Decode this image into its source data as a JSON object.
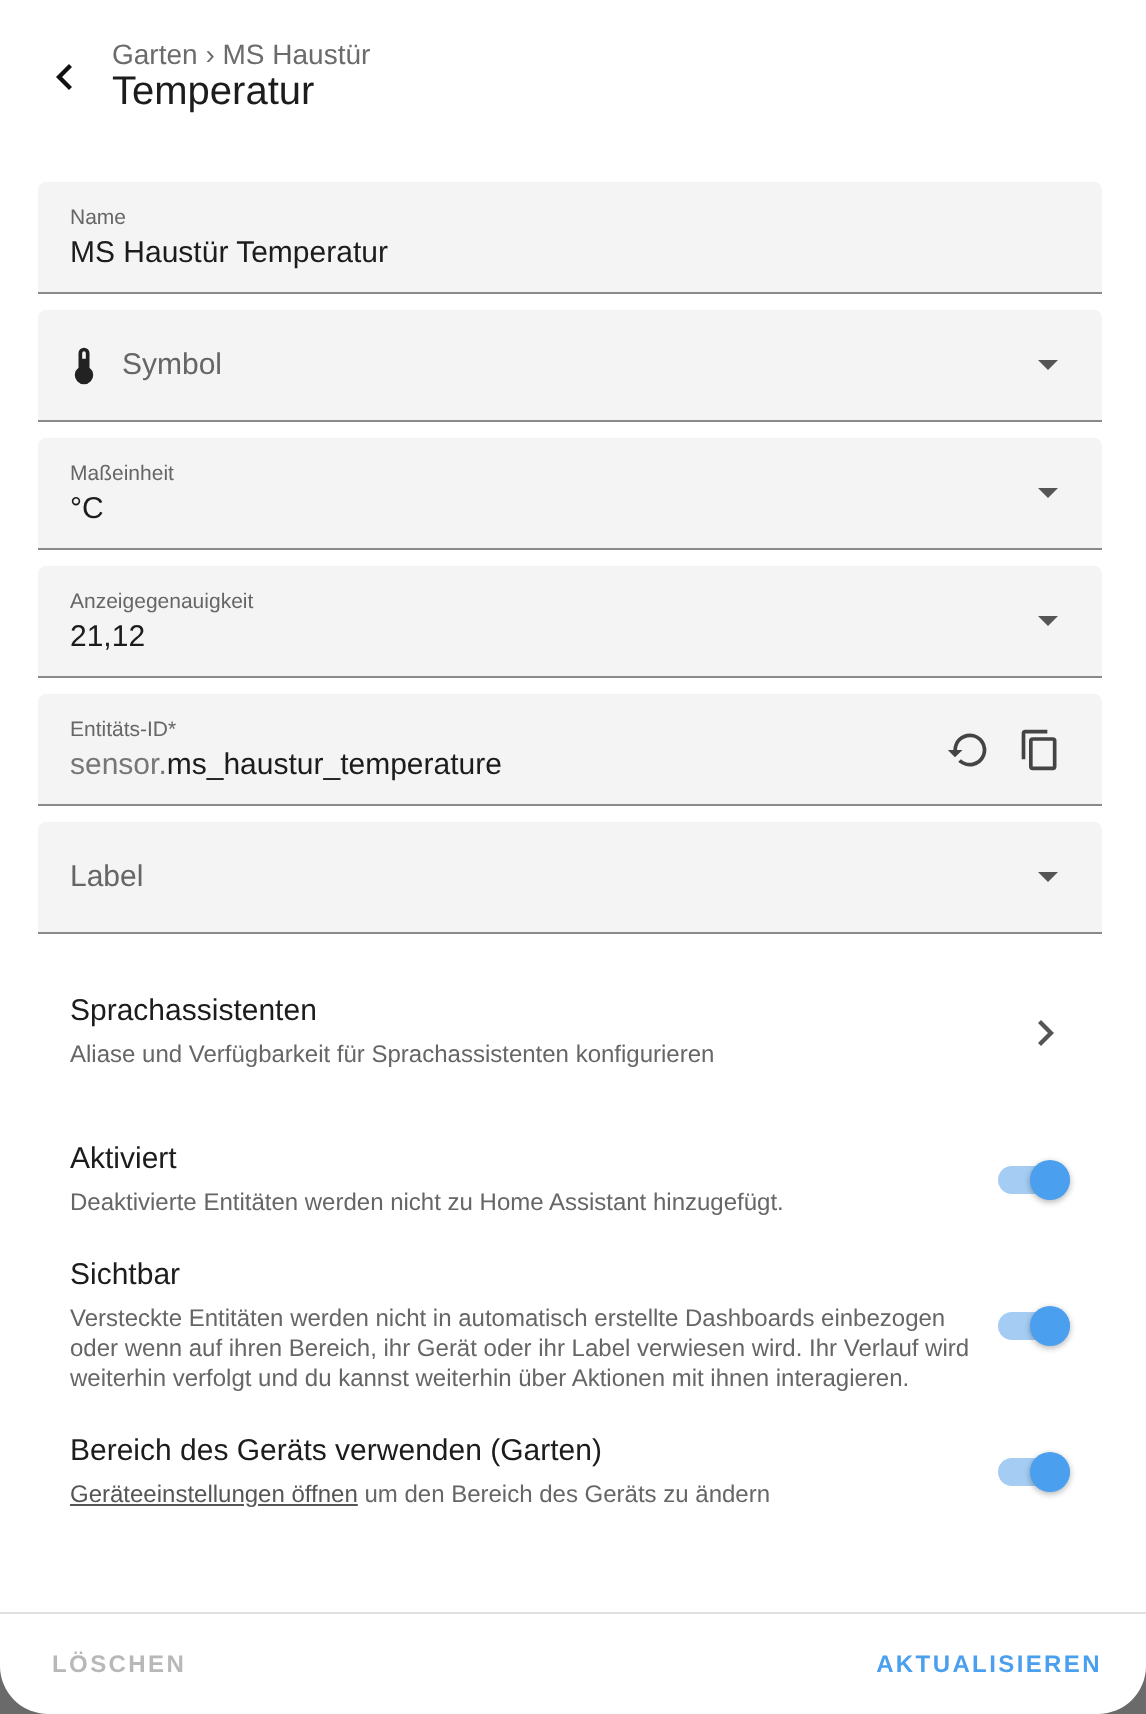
{
  "header": {
    "breadcrumb": "Garten › MS Haustür",
    "title": "Temperatur"
  },
  "fields": [
    {
      "kind": "text",
      "label": "Name",
      "value": "MS Haustür Temperatur"
    },
    {
      "kind": "icon-select",
      "placeholder": "Symbol"
    },
    {
      "kind": "select",
      "label": "Maßeinheit",
      "value": "°C"
    },
    {
      "kind": "select",
      "label": "Anzeigegenauigkeit",
      "value": "21,12"
    },
    {
      "kind": "entity",
      "label": "Entitäts-ID*",
      "prefix": "sensor.",
      "value": "ms_haustur_temperature"
    },
    {
      "kind": "select",
      "placeholder": "Label"
    }
  ],
  "nav": {
    "title": "Sprachassistenten",
    "description": "Aliase und Verfügbarkeit für Sprachassistenten konfigurieren"
  },
  "toggles": [
    {
      "title": "Aktiviert",
      "description": "Deaktivierte Entitäten werden nicht zu Home Assistant hinzugefügt.",
      "on": true
    },
    {
      "title": "Sichtbar",
      "description": "Versteckte Entitäten werden nicht in automatisch erstellte Dashboards einbezogen oder wenn auf ihren Bereich, ihr Gerät oder ihr Label verwiesen wird. Ihr Verlauf wird weiterhin verfolgt und du kannst weiterhin über Aktionen mit ihnen interagieren.",
      "on": true
    },
    {
      "title": "Bereich des Geräts verwenden (Garten)",
      "link": "Geräteeinstellungen öffnen",
      "description": "um den Bereich des Geräts zu ändern",
      "on": true
    }
  ],
  "buttons": [
    {
      "label": "LÖSCHEN",
      "disabled": true
    },
    {
      "label": "AKTUALISIEREN",
      "disabled": false
    }
  ]
}
